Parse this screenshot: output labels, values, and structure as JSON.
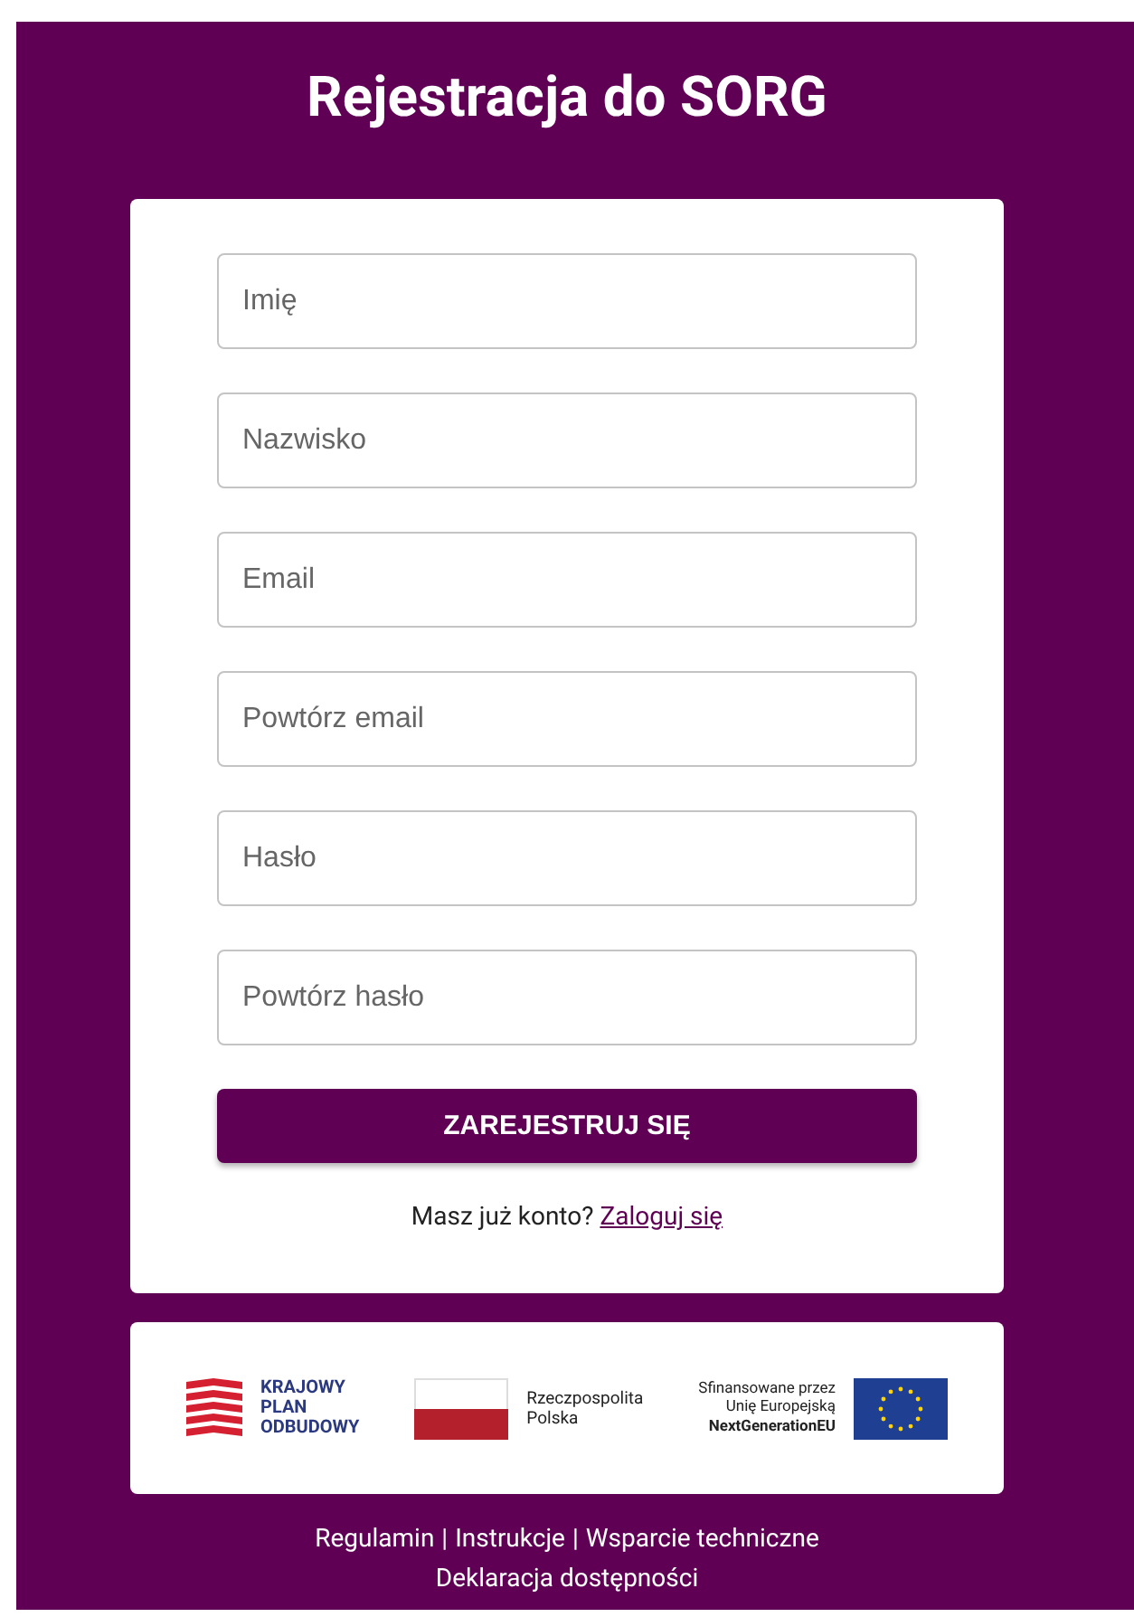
{
  "title": "Rejestracja do SORG",
  "fields": [
    {
      "placeholder": "Imię"
    },
    {
      "placeholder": "Nazwisko"
    },
    {
      "placeholder": "Email"
    },
    {
      "placeholder": "Powtórz email"
    },
    {
      "placeholder": "Hasło"
    },
    {
      "placeholder": "Powtórz hasło"
    }
  ],
  "submit_button": "ZAREJESTRUJ SIĘ",
  "login_prompt": {
    "text": "Masz już konto?",
    "link": "Zaloguj się"
  },
  "logos": [
    {
      "kind": "kpo",
      "lines": [
        "KRAJOWY",
        "PLAN",
        "ODBUDOWY"
      ]
    },
    {
      "kind": "poland",
      "lines": [
        "Rzeczpospolita",
        "Polska"
      ]
    },
    {
      "kind": "eu",
      "lines": [
        "Sfinansowane przez",
        "Unię Europejską",
        "NextGenerationEU"
      ]
    }
  ],
  "footer_links": [
    [
      "Regulamin",
      "Instrukcje",
      "Wsparcie techniczne"
    ],
    [
      "Deklaracja dostępności"
    ]
  ],
  "footer_separator": "|"
}
